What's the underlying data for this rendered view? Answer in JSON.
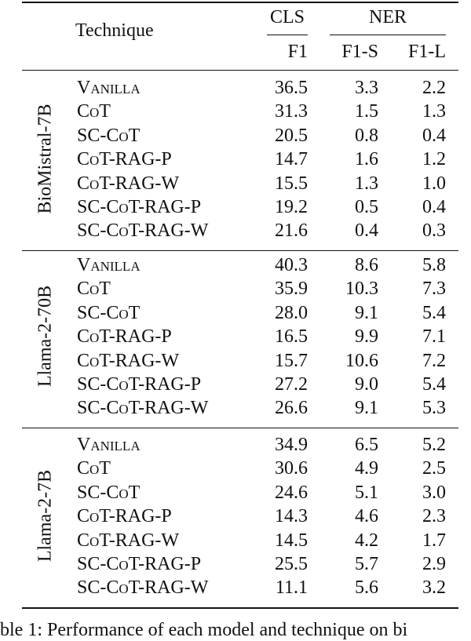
{
  "header": {
    "technique": "Technique",
    "groups": [
      {
        "label": "CLS",
        "subcolumns": [
          "F1"
        ]
      },
      {
        "label": "NER",
        "subcolumns": [
          "F1-S",
          "F1-L"
        ]
      }
    ]
  },
  "blocks": [
    {
      "model": "BioMistral-7B",
      "rows": [
        {
          "technique": "Vanilla",
          "cls_f1": "36.5",
          "ner_f1s": "3.3",
          "ner_f1l": "2.2"
        },
        {
          "technique": "CoT",
          "cls_f1": "31.3",
          "ner_f1s": "1.5",
          "ner_f1l": "1.3"
        },
        {
          "technique": "SC-CoT",
          "cls_f1": "20.5",
          "ner_f1s": "0.8",
          "ner_f1l": "0.4"
        },
        {
          "technique": "CoT-RAG-P",
          "cls_f1": "14.7",
          "ner_f1s": "1.6",
          "ner_f1l": "1.2"
        },
        {
          "technique": "CoT-RAG-W",
          "cls_f1": "15.5",
          "ner_f1s": "1.3",
          "ner_f1l": "1.0"
        },
        {
          "technique": "SC-CoT-RAG-P",
          "cls_f1": "19.2",
          "ner_f1s": "0.5",
          "ner_f1l": "0.4"
        },
        {
          "technique": "SC-CoT-RAG-W",
          "cls_f1": "21.6",
          "ner_f1s": "0.4",
          "ner_f1l": "0.3"
        }
      ]
    },
    {
      "model": "Llama-2-70B",
      "rows": [
        {
          "technique": "Vanilla",
          "cls_f1": "40.3",
          "ner_f1s": "8.6",
          "ner_f1l": "5.8"
        },
        {
          "technique": "CoT",
          "cls_f1": "35.9",
          "ner_f1s": "10.3",
          "ner_f1l": "7.3"
        },
        {
          "technique": "SC-CoT",
          "cls_f1": "28.0",
          "ner_f1s": "9.1",
          "ner_f1l": "5.4"
        },
        {
          "technique": "CoT-RAG-P",
          "cls_f1": "16.5",
          "ner_f1s": "9.9",
          "ner_f1l": "7.1"
        },
        {
          "technique": "CoT-RAG-W",
          "cls_f1": "15.7",
          "ner_f1s": "10.6",
          "ner_f1l": "7.2"
        },
        {
          "technique": "SC-CoT-RAG-P",
          "cls_f1": "27.2",
          "ner_f1s": "9.0",
          "ner_f1l": "5.4"
        },
        {
          "technique": "SC-CoT-RAG-W",
          "cls_f1": "26.6",
          "ner_f1s": "9.1",
          "ner_f1l": "5.3"
        }
      ]
    },
    {
      "model": "Llama-2-7B",
      "rows": [
        {
          "technique": "Vanilla",
          "cls_f1": "34.9",
          "ner_f1s": "6.5",
          "ner_f1l": "5.2"
        },
        {
          "technique": "CoT",
          "cls_f1": "30.6",
          "ner_f1s": "4.9",
          "ner_f1l": "2.5"
        },
        {
          "technique": "SC-CoT",
          "cls_f1": "24.6",
          "ner_f1s": "5.1",
          "ner_f1l": "3.0"
        },
        {
          "technique": "CoT-RAG-P",
          "cls_f1": "14.3",
          "ner_f1s": "4.6",
          "ner_f1l": "2.3"
        },
        {
          "technique": "CoT-RAG-W",
          "cls_f1": "14.5",
          "ner_f1s": "4.2",
          "ner_f1l": "1.7"
        },
        {
          "technique": "SC-CoT-RAG-P",
          "cls_f1": "25.5",
          "ner_f1s": "5.7",
          "ner_f1l": "2.9"
        },
        {
          "technique": "SC-CoT-RAG-W",
          "cls_f1": "11.1",
          "ner_f1s": "5.6",
          "ner_f1l": "3.2"
        }
      ]
    }
  ],
  "caption": "ble 1: Performance of each model and technique on bi"
}
